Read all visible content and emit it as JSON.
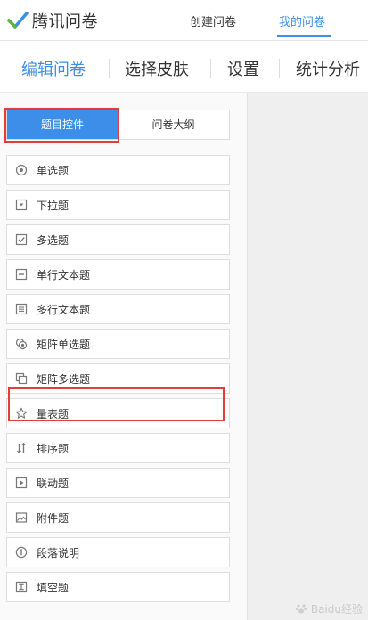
{
  "header": {
    "logo_text": "腾讯问卷",
    "nav_create": "创建问卷",
    "nav_mine": "我的问卷"
  },
  "tabs": [
    {
      "label": "编辑问卷",
      "active": true
    },
    {
      "label": "选择皮肤",
      "active": false
    },
    {
      "label": "设置",
      "active": false
    },
    {
      "label": "统计分析",
      "active": false
    }
  ],
  "panel": {
    "seg_controls": "题目控件",
    "seg_outline": "问卷大纲",
    "items": [
      {
        "label": "单选题",
        "icon": "radio-icon"
      },
      {
        "label": "下拉题",
        "icon": "dropdown-icon"
      },
      {
        "label": "多选题",
        "icon": "checkbox-icon"
      },
      {
        "label": "单行文本题",
        "icon": "single-line-text-icon"
      },
      {
        "label": "多行文本题",
        "icon": "multi-line-text-icon"
      },
      {
        "label": "矩阵单选题",
        "icon": "matrix-radio-icon"
      },
      {
        "label": "矩阵多选题",
        "icon": "matrix-checkbox-icon"
      },
      {
        "label": "量表题",
        "icon": "star-icon"
      },
      {
        "label": "排序题",
        "icon": "sort-icon"
      },
      {
        "label": "联动题",
        "icon": "linkage-icon"
      },
      {
        "label": "附件题",
        "icon": "image-attachment-icon"
      },
      {
        "label": "段落说明",
        "icon": "info-icon"
      },
      {
        "label": "填空题",
        "icon": "fill-blank-icon"
      }
    ]
  },
  "watermark": "Baidu经验",
  "colors": {
    "accent": "#3d8ee8",
    "highlight": "#e43b3b"
  }
}
